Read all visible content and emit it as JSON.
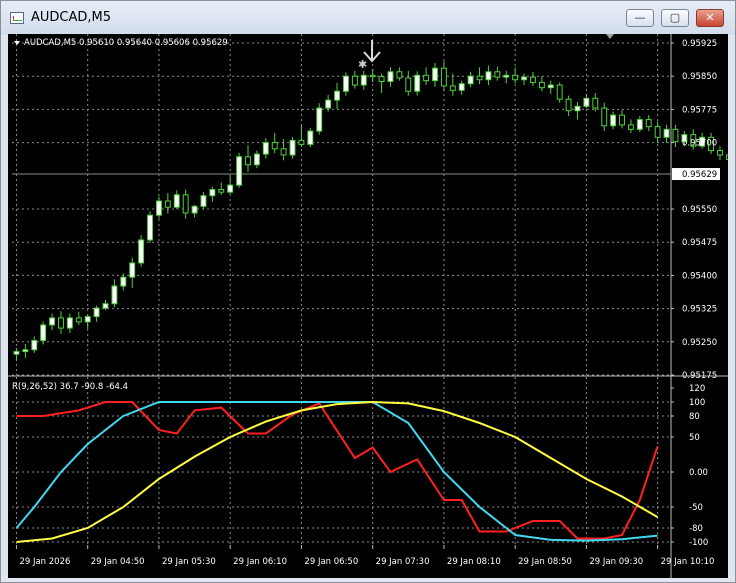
{
  "window": {
    "title": "AUDCAD,M5",
    "buttons": {
      "minimize": "—",
      "maximize": "▢",
      "close": "✕"
    }
  },
  "colors": {
    "background": "#000000",
    "grid": "#8a8a8a",
    "axis_text": "#ffffff",
    "candle_bull": "#ffffff",
    "candle_bear": "#000000",
    "candle_wick": "#4fd23c",
    "price_line": "#8a8a8a",
    "rsi_line": "#ff2020",
    "fast_line": "#40d8f0",
    "slow_line": "#ffff40"
  },
  "icons": {
    "chart_menu": "triangle-down-icon",
    "arrow_marker": "down-arrow-icon",
    "star_marker": "star-icon",
    "scroll_marker": "shift-triangle-icon"
  },
  "chart_data": [
    {
      "type": "candlestick",
      "header": "AUDCAD,M5  0.95610 0.95640 0.95606 0.95629",
      "symbol": "AUDCAD,M5",
      "ohlc_header": "0.95610 0.95640 0.95606 0.95629",
      "y_ticks": [
        "0.95925",
        "0.95850",
        "0.95775",
        "0.95700",
        "0.95629",
        "0.95550",
        "0.95475",
        "0.95400",
        "0.95325",
        "0.95250",
        "0.95175"
      ],
      "y_tick_values": [
        0.95925,
        0.9585,
        0.95775,
        0.957,
        0.9555,
        0.95475,
        0.954,
        0.95325,
        0.9525,
        0.95175
      ],
      "current_price": 0.95629,
      "current_price_label": "0.95629",
      "ylim": [
        0.95175,
        0.95925
      ],
      "grid": true,
      "candles": [
        {
          "o": 0.95222,
          "h": 0.95236,
          "l": 0.95207,
          "c": 0.95228
        },
        {
          "o": 0.95228,
          "h": 0.95245,
          "l": 0.95214,
          "c": 0.95232
        },
        {
          "o": 0.95232,
          "h": 0.95262,
          "l": 0.95225,
          "c": 0.95253
        },
        {
          "o": 0.95253,
          "h": 0.95296,
          "l": 0.95244,
          "c": 0.95288
        },
        {
          "o": 0.95288,
          "h": 0.95314,
          "l": 0.95276,
          "c": 0.95304
        },
        {
          "o": 0.95304,
          "h": 0.95319,
          "l": 0.95268,
          "c": 0.95281
        },
        {
          "o": 0.95281,
          "h": 0.95314,
          "l": 0.9527,
          "c": 0.95304
        },
        {
          "o": 0.95304,
          "h": 0.95318,
          "l": 0.95288,
          "c": 0.95295
        },
        {
          "o": 0.95295,
          "h": 0.95312,
          "l": 0.95279,
          "c": 0.95307
        },
        {
          "o": 0.95307,
          "h": 0.95332,
          "l": 0.95295,
          "c": 0.95326
        },
        {
          "o": 0.95326,
          "h": 0.95345,
          "l": 0.95322,
          "c": 0.95336
        },
        {
          "o": 0.95336,
          "h": 0.95391,
          "l": 0.95328,
          "c": 0.95376
        },
        {
          "o": 0.95376,
          "h": 0.95405,
          "l": 0.95366,
          "c": 0.95396
        },
        {
          "o": 0.95396,
          "h": 0.9544,
          "l": 0.95372,
          "c": 0.95428
        },
        {
          "o": 0.95428,
          "h": 0.95491,
          "l": 0.9542,
          "c": 0.9548
        },
        {
          "o": 0.9548,
          "h": 0.95545,
          "l": 0.95474,
          "c": 0.95536
        },
        {
          "o": 0.95536,
          "h": 0.95578,
          "l": 0.95528,
          "c": 0.95568
        },
        {
          "o": 0.95568,
          "h": 0.95586,
          "l": 0.9554,
          "c": 0.95554
        },
        {
          "o": 0.95554,
          "h": 0.95592,
          "l": 0.9555,
          "c": 0.95582
        },
        {
          "o": 0.95582,
          "h": 0.95594,
          "l": 0.95528,
          "c": 0.95541
        },
        {
          "o": 0.95541,
          "h": 0.95559,
          "l": 0.95531,
          "c": 0.95556
        },
        {
          "o": 0.95556,
          "h": 0.95588,
          "l": 0.95549,
          "c": 0.9558
        },
        {
          "o": 0.9558,
          "h": 0.956,
          "l": 0.95566,
          "c": 0.95594
        },
        {
          "o": 0.95594,
          "h": 0.9561,
          "l": 0.95582,
          "c": 0.95588
        },
        {
          "o": 0.95588,
          "h": 0.95626,
          "l": 0.95584,
          "c": 0.95604
        },
        {
          "o": 0.95604,
          "h": 0.95677,
          "l": 0.95598,
          "c": 0.95668
        },
        {
          "o": 0.95668,
          "h": 0.95694,
          "l": 0.95634,
          "c": 0.9565
        },
        {
          "o": 0.9565,
          "h": 0.95682,
          "l": 0.95642,
          "c": 0.95674
        },
        {
          "o": 0.95674,
          "h": 0.9571,
          "l": 0.95664,
          "c": 0.957
        },
        {
          "o": 0.957,
          "h": 0.95722,
          "l": 0.95676,
          "c": 0.95686
        },
        {
          "o": 0.95686,
          "h": 0.95708,
          "l": 0.9566,
          "c": 0.95672
        },
        {
          "o": 0.95672,
          "h": 0.95712,
          "l": 0.95664,
          "c": 0.95705
        },
        {
          "o": 0.95705,
          "h": 0.9574,
          "l": 0.9569,
          "c": 0.95696
        },
        {
          "o": 0.95696,
          "h": 0.95733,
          "l": 0.9569,
          "c": 0.95726
        },
        {
          "o": 0.95726,
          "h": 0.95789,
          "l": 0.95718,
          "c": 0.95778
        },
        {
          "o": 0.95778,
          "h": 0.95808,
          "l": 0.9577,
          "c": 0.95796
        },
        {
          "o": 0.95796,
          "h": 0.95835,
          "l": 0.95776,
          "c": 0.95816
        },
        {
          "o": 0.95816,
          "h": 0.95859,
          "l": 0.95806,
          "c": 0.9585
        },
        {
          "o": 0.9585,
          "h": 0.95862,
          "l": 0.95822,
          "c": 0.9583
        },
        {
          "o": 0.9583,
          "h": 0.95862,
          "l": 0.95819,
          "c": 0.95852
        },
        {
          "o": 0.95852,
          "h": 0.95866,
          "l": 0.95836,
          "c": 0.95849
        },
        {
          "o": 0.95849,
          "h": 0.95856,
          "l": 0.95812,
          "c": 0.95838
        },
        {
          "o": 0.95838,
          "h": 0.9587,
          "l": 0.95826,
          "c": 0.9586
        },
        {
          "o": 0.9586,
          "h": 0.9587,
          "l": 0.9584,
          "c": 0.95846
        },
        {
          "o": 0.95846,
          "h": 0.95862,
          "l": 0.95806,
          "c": 0.95816
        },
        {
          "o": 0.95816,
          "h": 0.95861,
          "l": 0.95806,
          "c": 0.95852
        },
        {
          "o": 0.95852,
          "h": 0.9587,
          "l": 0.9583,
          "c": 0.9584
        },
        {
          "o": 0.9584,
          "h": 0.9588,
          "l": 0.95826,
          "c": 0.95868
        },
        {
          "o": 0.95868,
          "h": 0.95884,
          "l": 0.95816,
          "c": 0.95828
        },
        {
          "o": 0.95828,
          "h": 0.95856,
          "l": 0.95806,
          "c": 0.95818
        },
        {
          "o": 0.95818,
          "h": 0.9584,
          "l": 0.95808,
          "c": 0.95833
        },
        {
          "o": 0.95833,
          "h": 0.9586,
          "l": 0.95825,
          "c": 0.9585
        },
        {
          "o": 0.9585,
          "h": 0.9587,
          "l": 0.95832,
          "c": 0.95842
        },
        {
          "o": 0.95842,
          "h": 0.95874,
          "l": 0.9583,
          "c": 0.9586
        },
        {
          "o": 0.9586,
          "h": 0.95872,
          "l": 0.9584,
          "c": 0.95848
        },
        {
          "o": 0.95848,
          "h": 0.95862,
          "l": 0.95834,
          "c": 0.95852
        },
        {
          "o": 0.95852,
          "h": 0.9587,
          "l": 0.95834,
          "c": 0.95842
        },
        {
          "o": 0.95842,
          "h": 0.95856,
          "l": 0.9583,
          "c": 0.95848
        },
        {
          "o": 0.95848,
          "h": 0.9586,
          "l": 0.95828,
          "c": 0.95836
        },
        {
          "o": 0.95836,
          "h": 0.9585,
          "l": 0.95816,
          "c": 0.95824
        },
        {
          "o": 0.95824,
          "h": 0.9584,
          "l": 0.9581,
          "c": 0.9583
        },
        {
          "o": 0.9583,
          "h": 0.95836,
          "l": 0.9579,
          "c": 0.95798
        },
        {
          "o": 0.95798,
          "h": 0.95806,
          "l": 0.9576,
          "c": 0.95772
        },
        {
          "o": 0.95772,
          "h": 0.95792,
          "l": 0.95752,
          "c": 0.95782
        },
        {
          "o": 0.95782,
          "h": 0.9581,
          "l": 0.95778,
          "c": 0.958
        },
        {
          "o": 0.958,
          "h": 0.95812,
          "l": 0.9577,
          "c": 0.95778
        },
        {
          "o": 0.95778,
          "h": 0.9579,
          "l": 0.95726,
          "c": 0.95738
        },
        {
          "o": 0.95738,
          "h": 0.9577,
          "l": 0.9573,
          "c": 0.95762
        },
        {
          "o": 0.95762,
          "h": 0.95774,
          "l": 0.95732,
          "c": 0.9574
        },
        {
          "o": 0.9574,
          "h": 0.95752,
          "l": 0.95722,
          "c": 0.9573
        },
        {
          "o": 0.9573,
          "h": 0.9576,
          "l": 0.95724,
          "c": 0.95752
        },
        {
          "o": 0.95752,
          "h": 0.95762,
          "l": 0.95726,
          "c": 0.95736
        },
        {
          "o": 0.95736,
          "h": 0.95748,
          "l": 0.957,
          "c": 0.95712
        },
        {
          "o": 0.95712,
          "h": 0.9574,
          "l": 0.957,
          "c": 0.9573
        },
        {
          "o": 0.9573,
          "h": 0.9574,
          "l": 0.9569,
          "c": 0.95702
        },
        {
          "o": 0.95702,
          "h": 0.95726,
          "l": 0.95692,
          "c": 0.95718
        },
        {
          "o": 0.95718,
          "h": 0.9573,
          "l": 0.95684,
          "c": 0.95692
        },
        {
          "o": 0.95692,
          "h": 0.95722,
          "l": 0.95686,
          "c": 0.95712
        },
        {
          "o": 0.95712,
          "h": 0.95722,
          "l": 0.95674,
          "c": 0.95682
        },
        {
          "o": 0.95682,
          "h": 0.95692,
          "l": 0.9566,
          "c": 0.95672
        },
        {
          "o": 0.95672,
          "h": 0.95684,
          "l": 0.9565,
          "c": 0.95662
        },
        {
          "o": 0.95662,
          "h": 0.95672,
          "l": 0.9562,
          "c": 0.9563
        },
        {
          "o": 0.9563,
          "h": 0.9565,
          "l": 0.95606,
          "c": 0.9562
        },
        {
          "o": 0.9562,
          "h": 0.95636,
          "l": 0.95578,
          "c": 0.95594
        },
        {
          "o": 0.95594,
          "h": 0.95614,
          "l": 0.95586,
          "c": 0.95602
        },
        {
          "o": 0.95602,
          "h": 0.95612,
          "l": 0.95572,
          "c": 0.95588
        },
        {
          "o": 0.95588,
          "h": 0.95604,
          "l": 0.95552,
          "c": 0.95594
        },
        {
          "o": 0.95594,
          "h": 0.95606,
          "l": 0.9556,
          "c": 0.95574
        },
        {
          "o": 0.95574,
          "h": 0.956,
          "l": 0.95562,
          "c": 0.95596
        },
        {
          "o": 0.95596,
          "h": 0.956,
          "l": 0.95558,
          "c": 0.95568
        },
        {
          "o": 0.95568,
          "h": 0.95598,
          "l": 0.95552,
          "c": 0.95588
        },
        {
          "o": 0.95588,
          "h": 0.956,
          "l": 0.95556,
          "c": 0.95564
        },
        {
          "o": 0.95564,
          "h": 0.95628,
          "l": 0.95558,
          "c": 0.95622
        },
        {
          "o": 0.95622,
          "h": 0.95648,
          "l": 0.95614,
          "c": 0.95626
        },
        {
          "o": 0.95626,
          "h": 0.95636,
          "l": 0.95604,
          "c": 0.95612
        },
        {
          "o": 0.9561,
          "h": 0.9564,
          "l": 0.95606,
          "c": 0.95629
        }
      ]
    },
    {
      "type": "line",
      "header": "R(9,26,52) 36.7 -90.8 -64.4",
      "y_ticks": [
        "120",
        "100",
        "80",
        "50",
        "0.00",
        "-50",
        "-80",
        "-100"
      ],
      "y_tick_values": [
        120,
        100,
        80,
        50,
        0,
        -50,
        -80,
        -100
      ],
      "ylim": [
        -100,
        120
      ],
      "grid": true,
      "x_ticks": [
        "29 Jan 2026",
        "29 Jan 04:50",
        "29 Jan 05:30",
        "29 Jan 06:10",
        "29 Jan 06:50",
        "29 Jan 07:30",
        "29 Jan 08:10",
        "29 Jan 08:50",
        "29 Jan 09:30",
        "29 Jan 10:10"
      ],
      "x_tick_bars": [
        0,
        8,
        16,
        24,
        32,
        40,
        48,
        56,
        64,
        72
      ],
      "bars_count": 74,
      "series": [
        {
          "color_key": "rsi_line",
          "x": [
            0,
            3,
            7,
            10,
            13,
            16,
            18,
            20,
            23,
            26,
            28,
            31,
            34,
            38,
            40,
            42,
            45,
            48,
            50,
            52,
            55,
            58,
            61,
            63,
            66,
            68,
            70,
            72
          ],
          "values": [
            80,
            80,
            88,
            100,
            100,
            60,
            55,
            88,
            92,
            55,
            55,
            82,
            98,
            20,
            35,
            0,
            18,
            -40,
            -40,
            -85,
            -85,
            -70,
            -70,
            -95,
            -95,
            -90,
            -40,
            36.7
          ]
        },
        {
          "color_key": "fast_line",
          "x": [
            0,
            2,
            5,
            8,
            12,
            16,
            20,
            24,
            28,
            32,
            36,
            40,
            44,
            48,
            52,
            56,
            60,
            64,
            68,
            72
          ],
          "values": [
            -80,
            -50,
            0,
            40,
            80,
            100,
            100,
            100,
            100,
            100,
            100,
            100,
            70,
            0,
            -50,
            -90,
            -97,
            -98,
            -96,
            -90.8
          ]
        },
        {
          "color_key": "slow_line",
          "x": [
            0,
            4,
            8,
            12,
            16,
            20,
            24,
            28,
            32,
            36,
            40,
            44,
            48,
            52,
            56,
            60,
            64,
            68,
            72
          ],
          "values": [
            -100,
            -95,
            -80,
            -50,
            -10,
            22,
            50,
            72,
            88,
            97,
            100,
            98,
            87,
            70,
            50,
            20,
            -10,
            -35,
            -64.4
          ]
        }
      ]
    }
  ]
}
